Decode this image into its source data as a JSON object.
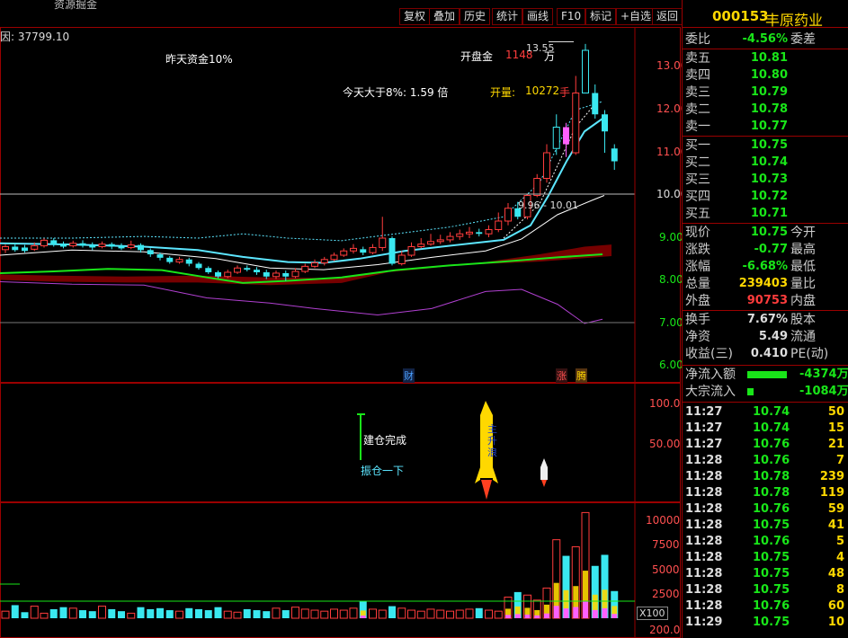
{
  "toolbar": {
    "title_truncated": "资源掘金",
    "buttons": [
      "复权",
      "叠加",
      "历史",
      "统计",
      "画线",
      "F10",
      "标记",
      "+自选",
      "返回"
    ]
  },
  "chart": {
    "factor_label": "因: 37799.10",
    "annot_yesterday": "昨天资金10%",
    "annot_open_gold_label": "开盘金",
    "annot_open_gold_value": "1148",
    "annot_open_gold_unit": "万",
    "annot_today": "今天大于8%: 1.59 倍",
    "annot_open_vol_label": "开量:",
    "annot_open_vol_value": "10272",
    "annot_open_vol_unit": "手",
    "high_price": "13.55",
    "range_label": "9.96 - 10.01",
    "y_axis": [
      "13.00",
      "12.00",
      "11.00",
      "10.00",
      "9.00",
      "8.00",
      "7.00",
      "6.00"
    ],
    "event_cai": "财",
    "event_zhang": "涨",
    "event_teng": "腾",
    "ind_axis": [
      "100.0",
      "50.00"
    ],
    "ind_label_build": "建仓完成",
    "ind_label_shake": "振仓一下",
    "ind_rocket_text": "主升浪",
    "vol_axis": [
      "10000",
      "7500",
      "5000",
      "2500"
    ],
    "vol_unit": "X100",
    "vol_bottom": "200.0",
    "colors": {
      "up": "#ff3c3c",
      "down": "#3ae8f0",
      "ma_short": "#5ce6ff",
      "ma_mid": "#ffffff",
      "ma_long": "#19e619",
      "bbu": "#b040d0",
      "band": "#8b0000"
    }
  },
  "quote": {
    "code": "000153",
    "name": "丰原药业",
    "weibi_label": "委比",
    "weibi_value": "-4.56%",
    "weicha_label": "委差",
    "sells": [
      {
        "label": "卖五",
        "price": "10.81"
      },
      {
        "label": "卖四",
        "price": "10.80"
      },
      {
        "label": "卖三",
        "price": "10.79"
      },
      {
        "label": "卖二",
        "price": "10.78"
      },
      {
        "label": "卖一",
        "price": "10.77"
      }
    ],
    "buys": [
      {
        "label": "买一",
        "price": "10.75"
      },
      {
        "label": "买二",
        "price": "10.74"
      },
      {
        "label": "买三",
        "price": "10.73"
      },
      {
        "label": "买四",
        "price": "10.72"
      },
      {
        "label": "买五",
        "price": "10.71"
      }
    ],
    "stats": [
      {
        "l": "现价",
        "v": "10.75",
        "c": "g",
        "l2": "今开"
      },
      {
        "l": "涨跌",
        "v": "-0.77",
        "c": "g",
        "l2": "最高"
      },
      {
        "l": "涨幅",
        "v": "-6.68%",
        "c": "g",
        "l2": "最低"
      },
      {
        "l": "总量",
        "v": "239403",
        "c": "y",
        "l2": "量比"
      },
      {
        "l": "外盘",
        "v": "90753",
        "c": "r",
        "l2": "内盘"
      }
    ],
    "stats2": [
      {
        "l": "换手",
        "v": "7.67%",
        "c": "w",
        "l2": "股本"
      },
      {
        "l": "净资",
        "v": "5.49",
        "c": "w",
        "l2": "流通"
      },
      {
        "l": "收益(三)",
        "v": "0.410",
        "c": "w",
        "l2": "PE(动)"
      }
    ],
    "flows": [
      {
        "l": "净流入额",
        "v": "-4374万",
        "fill": 0.8
      },
      {
        "l": "大宗流入",
        "v": "-1084万",
        "fill": 0.12
      }
    ],
    "ticks": [
      {
        "t": "11:27",
        "p": "10.74",
        "v": "50"
      },
      {
        "t": "11:27",
        "p": "10.74",
        "v": "15"
      },
      {
        "t": "11:27",
        "p": "10.76",
        "v": "21"
      },
      {
        "t": "11:28",
        "p": "10.76",
        "v": "7"
      },
      {
        "t": "11:28",
        "p": "10.78",
        "v": "239"
      },
      {
        "t": "11:28",
        "p": "10.78",
        "v": "119"
      },
      {
        "t": "11:28",
        "p": "10.76",
        "v": "59"
      },
      {
        "t": "11:28",
        "p": "10.75",
        "v": "41"
      },
      {
        "t": "11:28",
        "p": "10.76",
        "v": "5"
      },
      {
        "t": "11:28",
        "p": "10.75",
        "v": "4"
      },
      {
        "t": "11:28",
        "p": "10.75",
        "v": "48"
      },
      {
        "t": "11:28",
        "p": "10.75",
        "v": "8"
      },
      {
        "t": "11:28",
        "p": "10.76",
        "v": "60"
      },
      {
        "t": "11:29",
        "p": "10.75",
        "v": "10"
      }
    ]
  }
}
